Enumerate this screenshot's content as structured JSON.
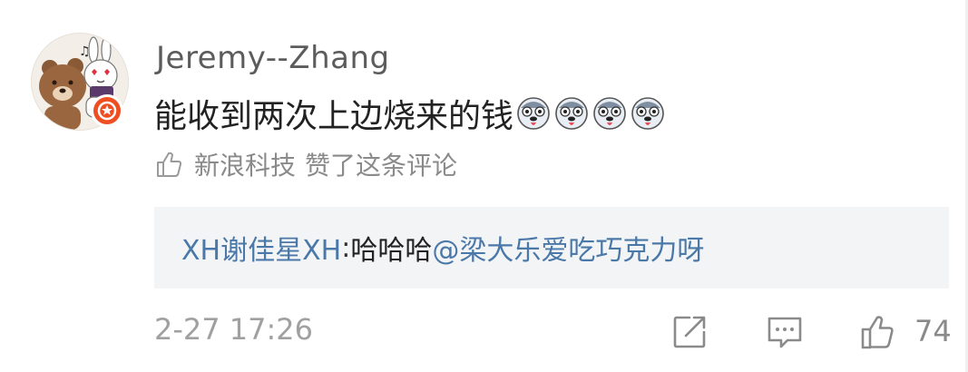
{
  "comment": {
    "username": "Jeremy--Zhang",
    "text": "能收到两次上边烧来的钱",
    "emojis": [
      "husky-emoji",
      "husky-emoji",
      "husky-emoji",
      "husky-emoji"
    ],
    "liked_by": "新浪科技",
    "liked_suffix": "赞了这条评论",
    "reply": {
      "user": "XH谢佳星XH",
      "colon": ": ",
      "text": "哈哈哈",
      "mention": "@梁大乐爱吃巧克力呀"
    },
    "timestamp": "2-27 17:26",
    "like_count": "74"
  },
  "colors": {
    "link": "#4a78a8",
    "badge": "#ee4e21",
    "muted": "#8a8a8a"
  }
}
